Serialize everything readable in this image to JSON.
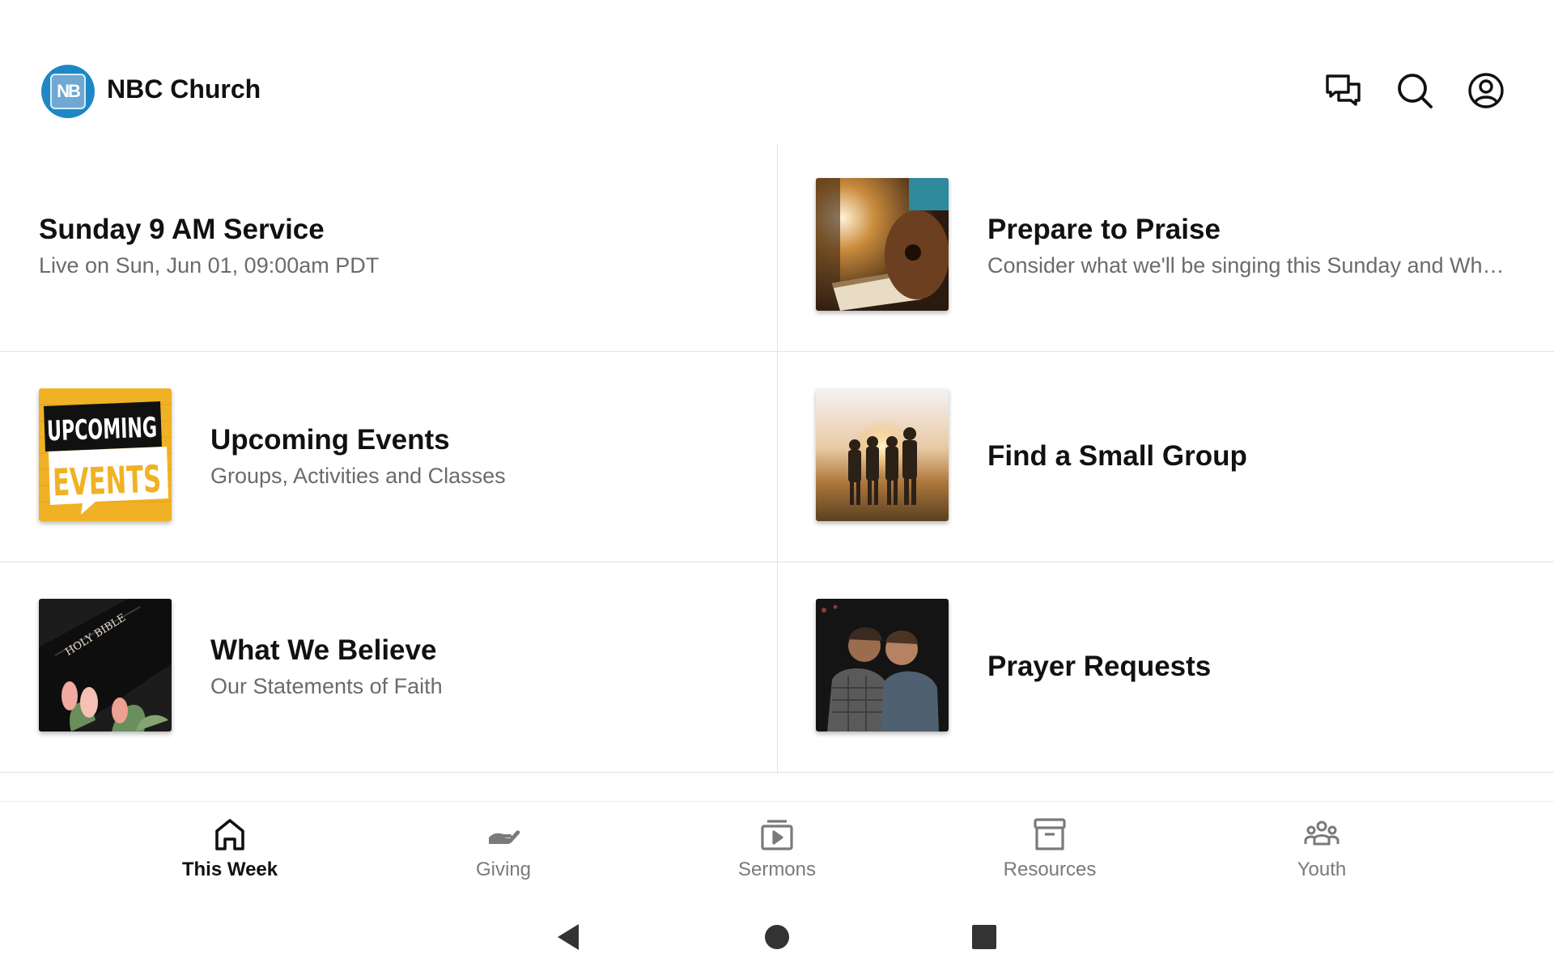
{
  "header": {
    "app_title": "NBC Church",
    "logo_text": "NB",
    "icons": [
      "chat-icon",
      "search-icon",
      "account-icon"
    ]
  },
  "cards": [
    {
      "title": "Sunday 9 AM Service",
      "subtitle": "Live on Sun, Jun 01, 09:00am PDT"
    },
    {
      "title": "Prepare to Praise",
      "subtitle": "Consider what we'll be singing this Sunday and Wh…",
      "image": "guitar-bible-photo"
    },
    {
      "title": "Upcoming Events",
      "subtitle": "Groups, Activities and Classes",
      "image": "upcoming-events-graphic",
      "image_text": [
        "UPCOMING",
        "EVENTS"
      ]
    },
    {
      "title": "Find a Small Group",
      "image": "group-sunset-photo"
    },
    {
      "title": "What We Believe",
      "subtitle": "Our Statements of Faith",
      "image": "holy-bible-tulips-photo",
      "image_text": "HOLY BIBLE"
    },
    {
      "title": "Prayer Requests",
      "image": "praying-men-photo"
    }
  ],
  "bottom_nav": [
    {
      "label": "This Week",
      "icon": "home-icon",
      "active": true
    },
    {
      "label": "Giving",
      "icon": "giving-hand-icon",
      "active": false
    },
    {
      "label": "Sermons",
      "icon": "video-play-icon",
      "active": false
    },
    {
      "label": "Resources",
      "icon": "archive-box-icon",
      "active": false
    },
    {
      "label": "Youth",
      "icon": "people-group-icon",
      "active": false
    }
  ],
  "system_nav": [
    "back-icon",
    "home-circle-icon",
    "recents-square-icon"
  ],
  "colors": {
    "brand_blue": "#1e88c7",
    "events_yellow": "#f0b224",
    "active_text": "#111111",
    "inactive_text": "#7a7a7a"
  }
}
